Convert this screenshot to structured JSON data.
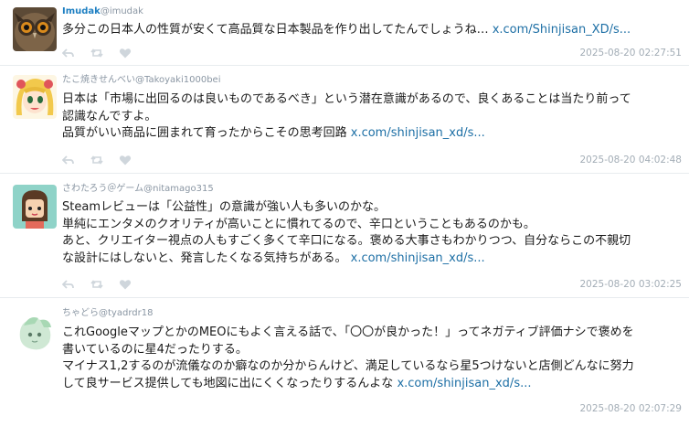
{
  "posts": [
    {
      "display_name": "Imudak",
      "handle": "@imudak",
      "lines": [
        "多分この日本人の性質が安くて高品質な日本製品を作り出してたんでしょうね… "
      ],
      "link": "x.com/Shinjisan_XD/s...",
      "timestamp": "2025-08-20 02:27:51",
      "avatar": "owl-avatar"
    },
    {
      "display_name": "たこ焼きせんべい",
      "handle": "@Takoyaki1000bei",
      "lines": [
        "日本は「市場に出回るのは良いものであるべき」という潜在意識があるので、良くあることは当たり前って",
        "認識なんですよ。",
        "品質がいい商品に囲まれて育ったからこその思考回路 "
      ],
      "link": "x.com/shinjisan_xd/s...",
      "timestamp": "2025-08-20 04:02:48",
      "avatar": "anime-girl-avatar"
    },
    {
      "display_name": "さわたろう＠ゲーム",
      "handle": "@nitamago315",
      "lines": [
        "Steamレビューは「公益性」の意識が強い人も多いのかな。",
        "単純にエンタメのクオリティが高いことに慣れてるので、辛口ということもあるのかも。",
        "あと、クリエイター視点の人もすごく多くて辛口になる。褒める大事さもわかりつつ、自分ならこの不親切",
        "な設計にはしないと、発言したくなる気持ちがある。 "
      ],
      "link": "x.com/shinjisan_xd/s...",
      "timestamp": "2025-08-20 03:02:25",
      "avatar": "villager-avatar"
    },
    {
      "display_name": "ちゃどら",
      "handle": "@tyadrdr18",
      "lines": [
        "これGoogleマップとかのMEOにもよく言える話で、「〇〇が良かった！」ってネガティブ評価ナシで褒めを",
        "書いているのに星4だったりする。",
        "マイナス1,2するのが流儀なのか癖なのか分からんけど、満足しているなら星5つけないと店側どんなに努力",
        "して良サービス提供しても地図に出にくくなったりするんよな "
      ],
      "link": "x.com/shinjisan_xd/s...",
      "timestamp": "2025-08-20 02:07:29",
      "avatar": "green-character-avatar"
    }
  ],
  "colors": {
    "link": "#1d6fa5",
    "name_primary": "#1d7fc2",
    "meta": "#8a96a3",
    "timestamp": "#a3adb6",
    "icon": "#cfd6dc",
    "divider": "#e8ecef"
  },
  "action_icons": [
    "reply-icon",
    "retweet-icon",
    "like-icon"
  ]
}
